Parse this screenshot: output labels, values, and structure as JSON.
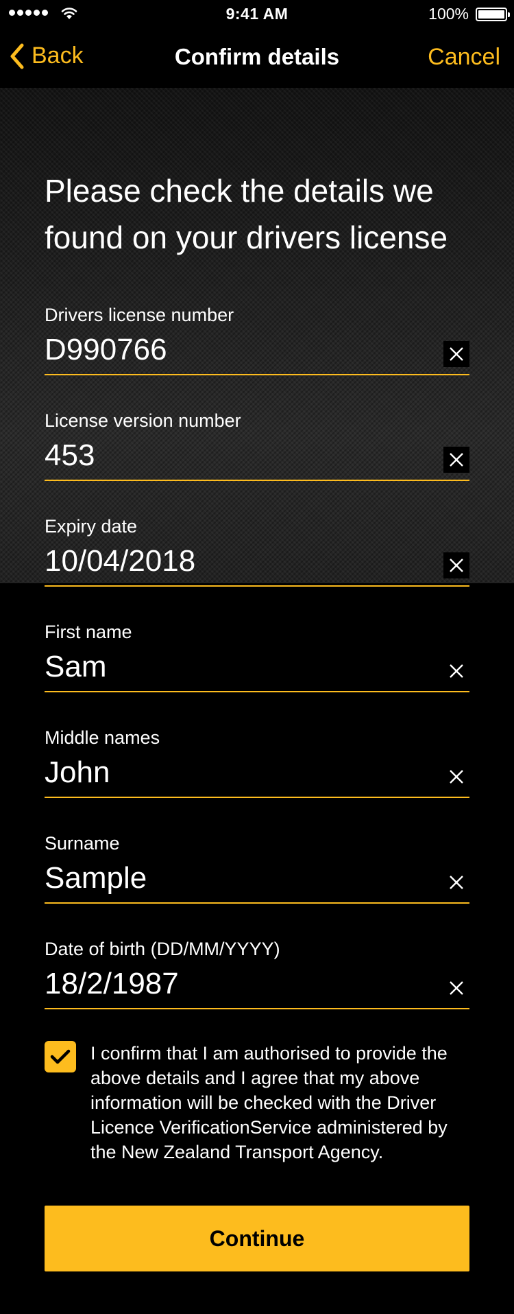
{
  "status_bar": {
    "time": "9:41 AM",
    "battery_percent": "100%",
    "signal_icon": "signal-dots-icon",
    "wifi_icon": "wifi-icon",
    "battery_icon": "battery-icon"
  },
  "nav": {
    "back_label": "Back",
    "title": "Confirm details",
    "cancel_label": "Cancel",
    "back_icon": "chevron-left-icon"
  },
  "heading": "Please check the details we found on your drivers license",
  "fields": [
    {
      "label": "Drivers license number",
      "value": "D990766"
    },
    {
      "label": "License version number",
      "value": "453"
    },
    {
      "label": "Expiry date",
      "value": "10/04/2018"
    },
    {
      "label": "First name",
      "value": "Sam"
    },
    {
      "label": "Middle names",
      "value": "John"
    },
    {
      "label": "Surname",
      "value": "Sample"
    },
    {
      "label": "Date of birth (DD/MM/YYYY)",
      "value": "18/2/1987"
    }
  ],
  "clear_icon": "close-icon",
  "confirm": {
    "checked": true,
    "icon": "checkmark-icon",
    "text": "I confirm that I am authorised to provide the above details and I agree that my above information will be checked with the Driver Licence VerificationService administered by the New Zealand Transport Agency."
  },
  "continue_label": "Continue",
  "colors": {
    "accent": "#fdbc1e",
    "background": "#000000",
    "text": "#ffffff"
  }
}
